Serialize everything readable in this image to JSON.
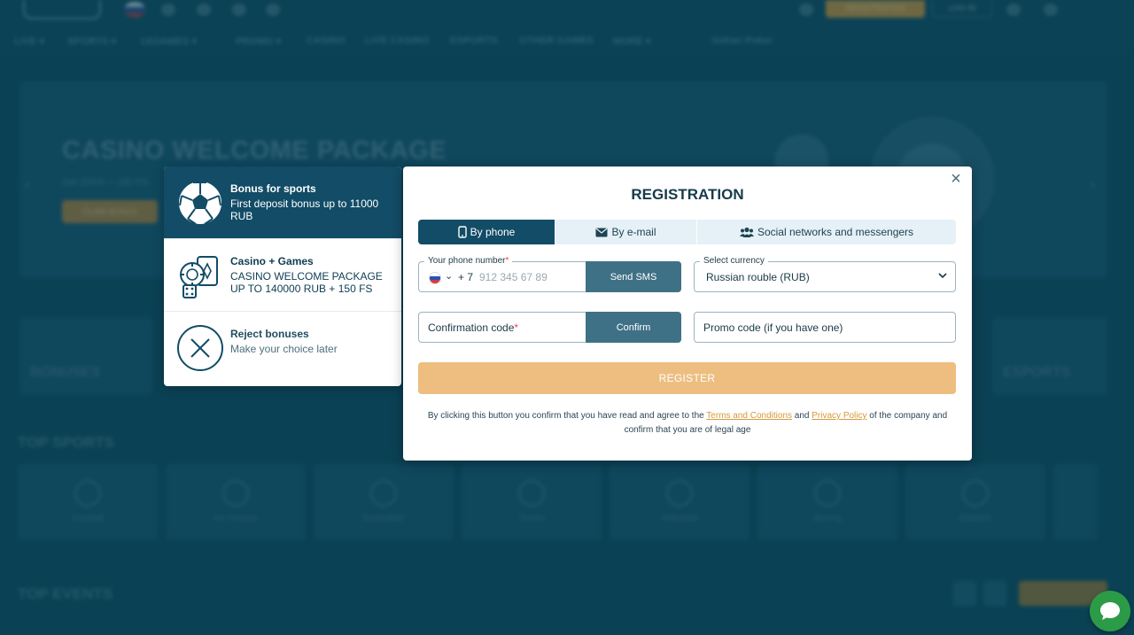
{
  "background": {
    "top_buttons": {
      "register": "REGISTRATION",
      "login": "LOG IN"
    },
    "nav": [
      "LIVE ▾",
      "SPORTS ▾",
      "1XGAMES ▾",
      "PROMO ▾",
      "CASINO",
      "LIVE CASINO",
      "ESPORTS",
      "OTHER GAMES",
      "MORE ▾",
      "Indian Poker"
    ],
    "hero": {
      "title": "CASINO WELCOME PACKAGE",
      "subtitle": "Get 200% + 150 FS",
      "button": "CLAIM BONUS"
    },
    "categories": [
      "BONUSES",
      "ESPORTS"
    ],
    "top_sports_title": "TOP SPORTS",
    "sports": [
      "Football",
      "Ice Hockey",
      "Basketball",
      "Tennis",
      "Volleyball",
      "Boxing",
      "Biathlon"
    ],
    "top_events_title": "TOP EVENTS"
  },
  "bonus_panel": {
    "items": [
      {
        "title": "Bonus for sports",
        "desc": "First deposit bonus up to 11000 RUB",
        "icon": "soccer-ball-icon"
      },
      {
        "title": "Casino + Games",
        "desc": "CASINO WELCOME PACKAGE UP TO 140000 RUB + 150 FS",
        "icon": "casino-chips-cards-icon"
      },
      {
        "title": "Reject bonuses",
        "desc": "Make your choice later",
        "icon": "reject-x-icon"
      }
    ]
  },
  "modal": {
    "title": "REGISTRATION",
    "close": "×",
    "tabs": [
      {
        "label": "By phone",
        "icon": "phone-icon",
        "active": true
      },
      {
        "label": "By e-mail",
        "icon": "envelope-icon",
        "active": false
      },
      {
        "label": "Social networks and messengers",
        "icon": "users-icon",
        "active": false
      }
    ],
    "phone": {
      "label": "Your phone number",
      "required_mark": "*",
      "country_code": "+ 7",
      "placeholder": "912 345 67 89",
      "send_sms": "Send SMS"
    },
    "currency": {
      "label": "Select currency",
      "value": "Russian rouble (RUB)"
    },
    "confirmation": {
      "placeholder": "Confirmation code",
      "required_mark": "*",
      "confirm": "Confirm"
    },
    "promo": {
      "placeholder": "Promo code (if you have one)"
    },
    "register": "REGISTER",
    "disclaimer": {
      "part1": "By clicking this button you confirm that you have read and agree to the ",
      "terms": "Terms and Conditions",
      "and": " and ",
      "privacy": "Privacy Policy",
      "part2": " of the company and confirm that you are of legal age"
    }
  },
  "colors": {
    "background": "#0d4a60",
    "active_tab": "#124c66",
    "register_button": "#edbe80",
    "link": "#d49a3b",
    "chat": "#2c9b47"
  }
}
